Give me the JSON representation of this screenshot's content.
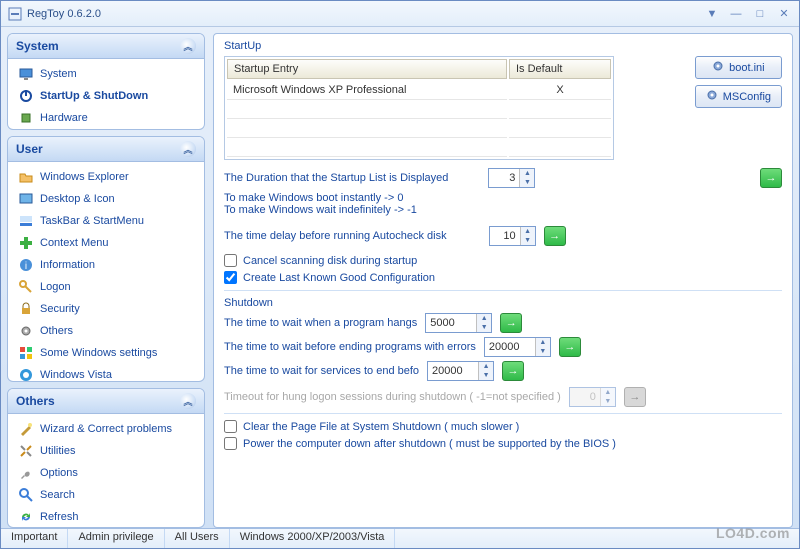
{
  "window": {
    "title": "RegToy 0.6.2.0"
  },
  "sidebar": {
    "system": {
      "title": "System",
      "items": [
        {
          "label": "System",
          "icon": "monitor-icon"
        },
        {
          "label": "StartUp & ShutDown",
          "icon": "power-icon",
          "active": true
        },
        {
          "label": "Hardware",
          "icon": "chip-icon"
        }
      ]
    },
    "user": {
      "title": "User",
      "items": [
        {
          "label": "Windows Explorer",
          "icon": "folder-icon"
        },
        {
          "label": "Desktop & Icon",
          "icon": "desktop-icon"
        },
        {
          "label": "TaskBar & StartMenu",
          "icon": "taskbar-icon"
        },
        {
          "label": "Context Menu",
          "icon": "plus-icon"
        },
        {
          "label": "Information",
          "icon": "info-icon"
        },
        {
          "label": "Logon",
          "icon": "key-icon"
        },
        {
          "label": "Security",
          "icon": "lock-icon"
        },
        {
          "label": "Others",
          "icon": "gear-icon"
        },
        {
          "label": "Some Windows settings",
          "icon": "windows-icon"
        },
        {
          "label": "Windows Vista",
          "icon": "vista-icon"
        }
      ]
    },
    "others": {
      "title": "Others",
      "items": [
        {
          "label": "Wizard & Correct problems",
          "icon": "wizard-icon"
        },
        {
          "label": "Utilities",
          "icon": "tools-icon"
        },
        {
          "label": "Options",
          "icon": "wrench-icon"
        },
        {
          "label": "Search",
          "icon": "search-icon"
        },
        {
          "label": "Refresh",
          "icon": "refresh-icon"
        }
      ]
    }
  },
  "startup": {
    "title": "StartUp",
    "table": {
      "columns": [
        "Startup Entry",
        "Is Default"
      ],
      "rows": [
        {
          "entry": "Microsoft Windows XP Professional",
          "default": "X"
        }
      ],
      "empty_rows": 3
    },
    "buttons": {
      "bootini": "boot.ini",
      "msconfig": "MSConfig"
    },
    "duration_label": "The Duration that the Startup List is Displayed",
    "duration_value": "3",
    "duration_hint1": "To make Windows boot instantly -> 0",
    "duration_hint2": "To make Windows wait indefinitely -> -1",
    "autocheck_label": "The time delay before running Autocheck disk",
    "autocheck_value": "10",
    "cancel_scan": {
      "label": "Cancel scanning disk during startup",
      "checked": false
    },
    "lkgc": {
      "label": "Create Last Known Good Configuration",
      "checked": true
    }
  },
  "shutdown": {
    "title": "Shutdown",
    "hang_label": "The time to wait when a program hangs",
    "hang_value": "5000",
    "errors_label": "The time to wait before ending programs with errors",
    "errors_value": "20000",
    "services_label": "The time to wait for services to end befo",
    "services_value": "20000",
    "timeout_label": "Timeout for hung logon sessions during shutdown ( -1=not specified )",
    "timeout_value": "0",
    "clear_page": {
      "label": "Clear the Page File at System Shutdown ( much slower )",
      "checked": false
    },
    "power_down": {
      "label": "Power the computer down after shutdown ( must be supported by the BIOS )",
      "checked": false
    }
  },
  "statusbar": {
    "cells": [
      "Important",
      "Admin privilege",
      "All Users",
      "Windows 2000/XP/2003/Vista"
    ]
  },
  "watermark": "LO4D.com"
}
